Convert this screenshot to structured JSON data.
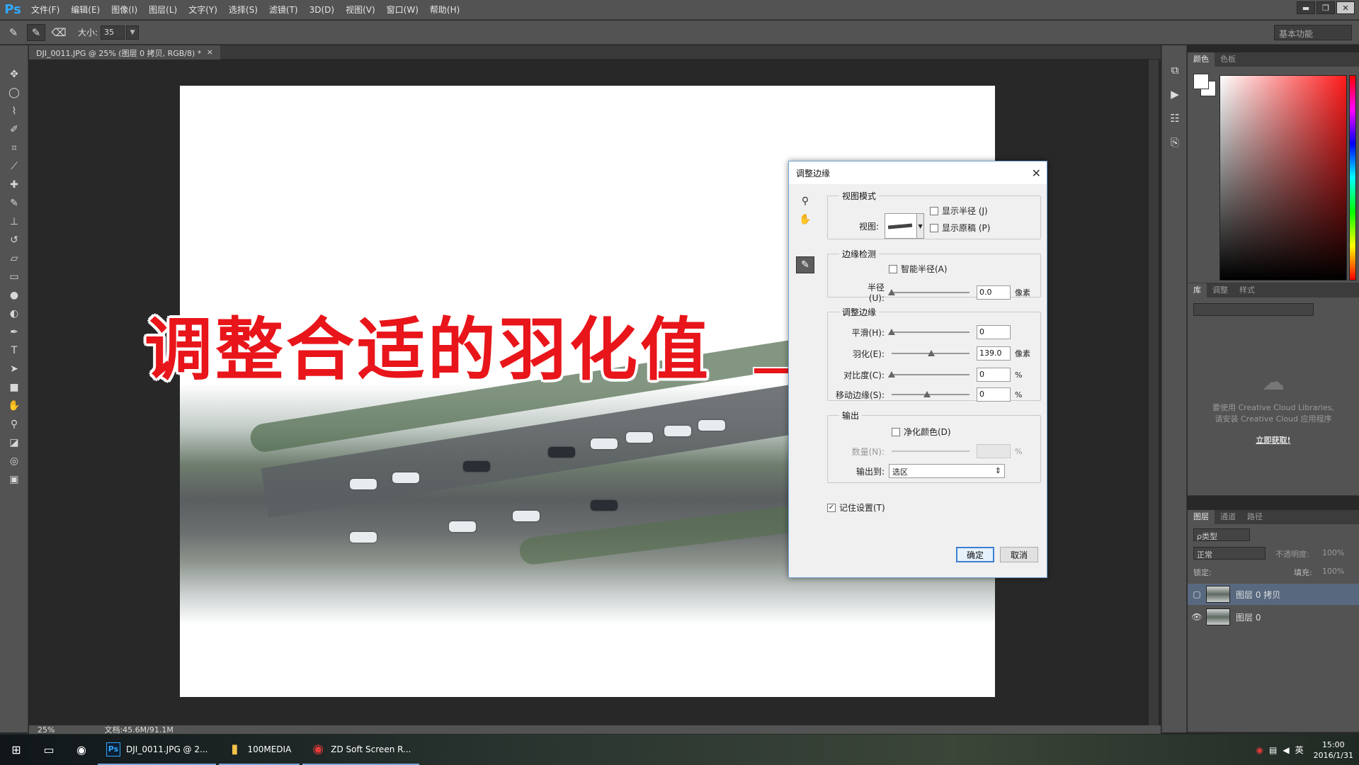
{
  "app": {
    "logo": "Ps"
  },
  "menu": [
    "文件(F)",
    "编辑(E)",
    "图像(I)",
    "图层(L)",
    "文字(Y)",
    "选择(S)",
    "滤镜(T)",
    "3D(D)",
    "视图(V)",
    "窗口(W)",
    "帮助(H)"
  ],
  "window_controls": {
    "minimize": "▬",
    "restore": "❐",
    "close": "✕"
  },
  "options": {
    "size_label": "大小:",
    "size_value": "35",
    "workspace": "基本功能"
  },
  "document": {
    "tab_title": "DJI_0011.JPG @ 25% (图层 0 拷贝, RGB/8) *",
    "tab_close": "×"
  },
  "annotation": {
    "text": "调整合适的羽化值",
    "color": "#e8151a"
  },
  "dialog": {
    "title": "调整边缘",
    "close": "✕",
    "view_mode": {
      "title": "视图模式",
      "view_label": "视图:",
      "show_radius": "显示半径 (J)",
      "show_original": "显示原稿 (P)"
    },
    "edge_detection": {
      "title": "边缘检测",
      "smart_radius": "智能半径(A)",
      "radius_label": "半径(U):",
      "radius_value": "0.0",
      "radius_unit": "像素",
      "radius_fraction": 0.0
    },
    "adjust_edge": {
      "title": "调整边缘",
      "smooth_label": "平滑(H):",
      "smooth_value": "0",
      "smooth_fraction": 0.0,
      "feather_label": "羽化(E):",
      "feather_value": "139.0",
      "feather_unit": "像素",
      "feather_fraction": 0.56,
      "contrast_label": "对比度(C):",
      "contrast_value": "0",
      "contrast_unit": "%",
      "contrast_fraction": 0.0,
      "shift_label": "移动边缘(S):",
      "shift_value": "0",
      "shift_unit": "%",
      "shift_fraction": 0.5
    },
    "output": {
      "title": "输出",
      "decontaminate": "净化颜色(D)",
      "amount_label": "数量(N):",
      "amount_unit": "%",
      "amount_fraction": 1.0,
      "output_to_label": "输出到:",
      "output_to_value": "选区"
    },
    "remember": "记住设置(T)",
    "ok": "确定",
    "cancel": "取消"
  },
  "panels": {
    "color_tabs": [
      "颜色",
      "色板"
    ],
    "library_tabs": [
      "库",
      "调整",
      "样式"
    ],
    "library_message_1": "要使用 Creative Cloud Libraries,",
    "library_message_2": "请安装 Creative Cloud 应用程序",
    "library_link": "立即获取!",
    "layers_tabs": [
      "图层",
      "通道",
      "路径"
    ],
    "kind_filter": "ρ类型",
    "blend_mode": "正常",
    "opacity_label": "不透明度:",
    "opacity_value": "100%",
    "lock_label": "锁定:",
    "fill_label": "填充:",
    "fill_value": "100%",
    "layers": [
      {
        "name": "图层 0 拷贝",
        "selected": true,
        "visible": false
      },
      {
        "name": "图层 0",
        "selected": false,
        "visible": true
      }
    ]
  },
  "status": {
    "zoom": "25%",
    "doc_size": "文档:45.6M/91.1M"
  },
  "taskbar": {
    "apps": [
      {
        "icon": "Ps",
        "label": "DJI_0011.JPG @ 2..."
      },
      {
        "icon": "▮",
        "label": "100MEDIA"
      },
      {
        "icon": "◉",
        "label": "ZD Soft Screen R..."
      }
    ],
    "ime": "英",
    "time": "15:00",
    "date": "2016/1/31"
  }
}
